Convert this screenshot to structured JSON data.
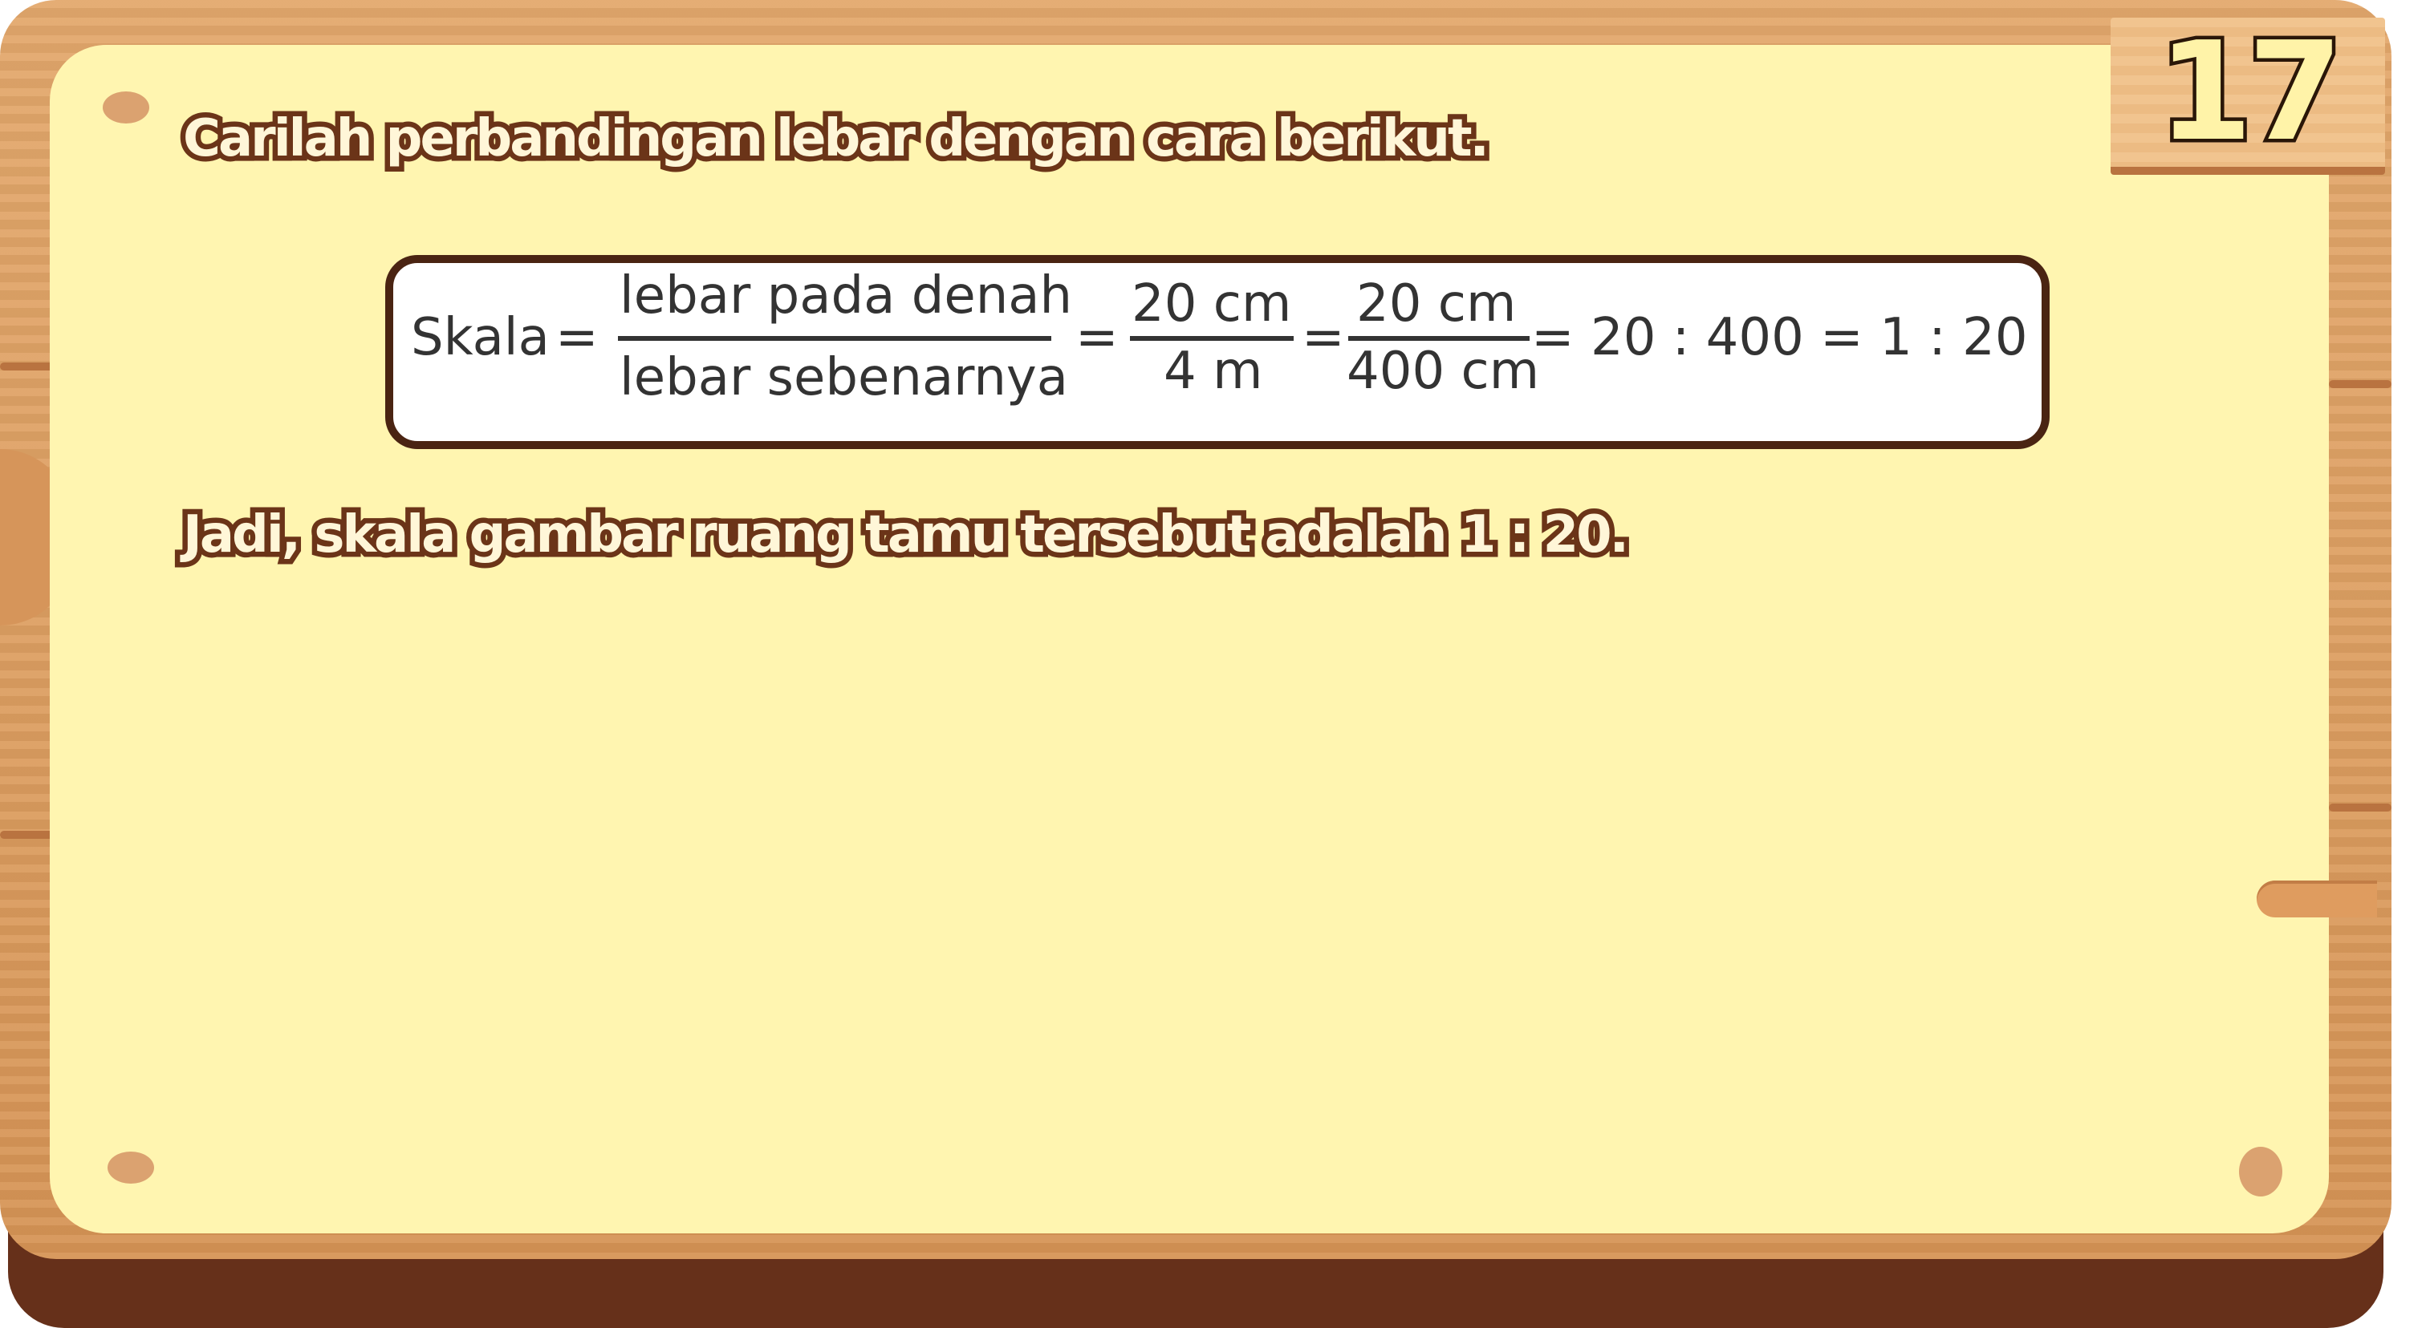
{
  "slide_number": "17",
  "instruction": "Carilah perbandingan lebar dengan cara berikut.",
  "formula": {
    "lhs": "Skala",
    "eq1": "=",
    "frac1_num": "lebar pada denah",
    "frac1_den": "lebar sebenarnya",
    "eq2": "=",
    "frac2_num": "20 cm",
    "frac2_den": "4 m",
    "eq3": "=",
    "frac3_num": "20 cm",
    "frac3_den": "400 cm",
    "result": "= 20 : 400 = 1 : 20"
  },
  "conclusion": "Jadi, skala gambar ruang tamu tersebut adalah 1 : 20.",
  "colors": {
    "paper": "#fff5b0",
    "wood": "#dd9f62",
    "wood_dark": "#66301a",
    "text_outline": "#6b3418",
    "formula_text": "#333333"
  }
}
